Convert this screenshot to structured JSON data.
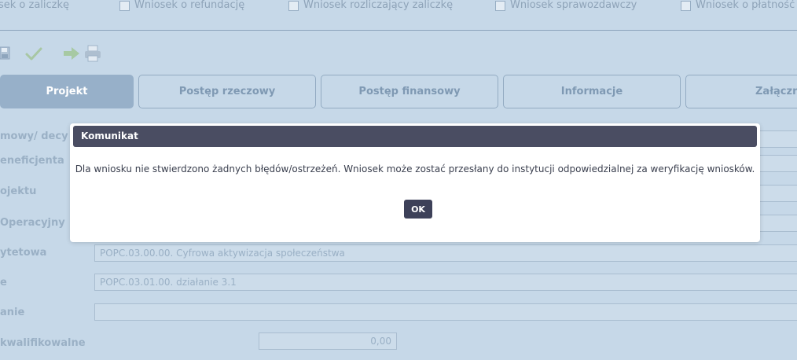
{
  "application_types": [
    {
      "label": "sek o zaliczkę"
    },
    {
      "label": "Wniosek o refundację"
    },
    {
      "label": "Wniosek rozliczający zaliczkę"
    },
    {
      "label": "Wniosek sprawozdawczy"
    },
    {
      "label": "Wniosek o płatność"
    }
  ],
  "toolbar": {
    "icons": [
      "save-icon",
      "check-icon",
      "send-arrow-icon",
      "print-icon"
    ]
  },
  "tabs": [
    {
      "label": "Projekt",
      "active": true
    },
    {
      "label": "Postęp rzeczowy",
      "active": false
    },
    {
      "label": "Postęp finansowy",
      "active": false
    },
    {
      "label": "Informacje",
      "active": false
    },
    {
      "label": "Załącznik",
      "active": false
    }
  ],
  "form": {
    "rows": [
      {
        "label": "mowy/ decy",
        "value": ""
      },
      {
        "label": "eneficjenta",
        "value": ""
      },
      {
        "label": "ojektu",
        "value": ""
      },
      {
        "label": "Operacyjny",
        "value": ""
      },
      {
        "label": "ytetowa",
        "value": "POPC.03.00.00. Cyfrowa aktywizacja społeczeństwa"
      },
      {
        "label": "e",
        "value": "POPC.03.01.00. działanie 3.1"
      },
      {
        "label": "anie",
        "value": ""
      },
      {
        "label": "kwalifikowalne",
        "value": "0,00"
      }
    ]
  },
  "modal": {
    "title": "Komunikat",
    "message": "Dla wniosku nie stwierdzono żadnych błędów/ostrzeżeń. Wniosek może zostać przesłany do instytucji odpowiedzialnej za weryfikację wniosków.",
    "ok_label": "OK"
  },
  "colors": {
    "background": "#c6d8e8",
    "active_tab": "#97b0c9",
    "modal_header": "#4a4d62",
    "ok_button": "#3d4159"
  }
}
